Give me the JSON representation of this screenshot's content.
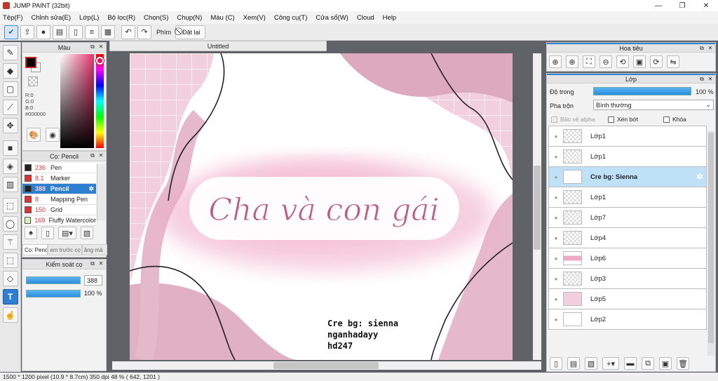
{
  "window": {
    "title": "JUMP PAINT (32bit)",
    "min": "—",
    "max": "❐",
    "close": "✕"
  },
  "menu": [
    "Tệp(F)",
    "Chỉnh sửa(E)",
    "Lớp(L)",
    "Bộ lọc(R)",
    "Chọn(S)",
    "Chụp(N)",
    "Màu (C)",
    "Xem(V)",
    "Công cụ(T)",
    "Cửa sổ(W)",
    "Cloud",
    "Help"
  ],
  "toolbar": {
    "snap_label": "Phím",
    "reset_label": "Đặt lại"
  },
  "color_panel": {
    "title": "Màu",
    "r": "R:0",
    "g": "G:0",
    "b": "B:0",
    "hex": "#000000"
  },
  "brush_panel": {
    "title": "Cọ: Pencil",
    "items": [
      {
        "size": "236",
        "name": "Pen",
        "color": "#222222"
      },
      {
        "size": "8.1",
        "name": "Marker",
        "color": "#e03030"
      },
      {
        "size": "388",
        "name": "Pencil",
        "color": "#222222"
      },
      {
        "size": "8",
        "name": "Mapping Pen",
        "color": "#e03030"
      },
      {
        "size": "150",
        "name": "Grid",
        "color": "#e03030"
      },
      {
        "size": "169",
        "name": "Fluffy Watercolor",
        "color": "#d8f0c0"
      }
    ],
    "tabs": [
      "Cọ: Penc",
      "em trước cọ",
      "ăng mà"
    ]
  },
  "brush_control": {
    "title": "Kiểm soát cọ",
    "size_value": "388",
    "opacity_value": "100 %"
  },
  "document": {
    "tab": "Untitled"
  },
  "artwork": {
    "main_text": "Cha và con gái",
    "credit_lines": [
      "Cre bg: sienna",
      "nganhadayy",
      "hd247"
    ]
  },
  "navigator": {
    "title": "Hoa tiêu"
  },
  "layer_panel": {
    "title": "Lớp",
    "opacity_label": "Độ trong",
    "opacity_value": "100 %",
    "blend_label": "Pha trộn",
    "blend_value": "Bình thường",
    "protect_alpha": "Bảo vệ alpha",
    "clip": "Xén bớt",
    "lock": "Khóa",
    "layers": [
      "Lớp1",
      "Lớp1",
      "Cre bg: Sienna",
      "Lớp1",
      "Lớp7",
      "Lớp4",
      "Lớp6",
      "Lớp3",
      "Lớp5",
      "Lớp2"
    ]
  },
  "status": {
    "text": "1500 * 1200 pixel   (10.9 * 8.7cm)   350 dpi   48 %   ( 642, 1201 )"
  },
  "colors": {
    "accent": "#2d7fd1",
    "pink": "#e6a6bd",
    "selected_layer": "#bfe1f7"
  }
}
